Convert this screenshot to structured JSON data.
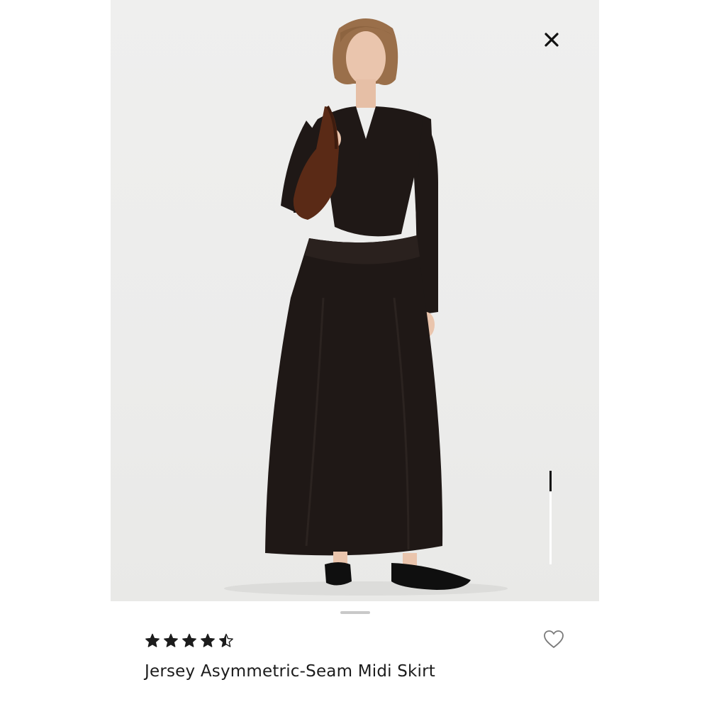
{
  "viewer": {
    "image_alt": "Model wearing black jersey asymmetric-seam midi skirt with black long-sleeve top and brown suede bag",
    "close_icon": "close-icon",
    "gallery_scroll": {
      "position_fraction": 0.0,
      "thumb_fraction": 0.22
    }
  },
  "product": {
    "rating": 4.5,
    "rating_max": 5,
    "star_icon": "star-icon",
    "name": "Jersey Asymmetric-Seam Midi Skirt",
    "favorite_icon": "heart-outline-icon"
  },
  "colors": {
    "text": "#1c1c1c",
    "background": "#ffffff",
    "photo_background": "#ecebea",
    "garment": "#1f1816",
    "bag": "#5a2a16"
  }
}
